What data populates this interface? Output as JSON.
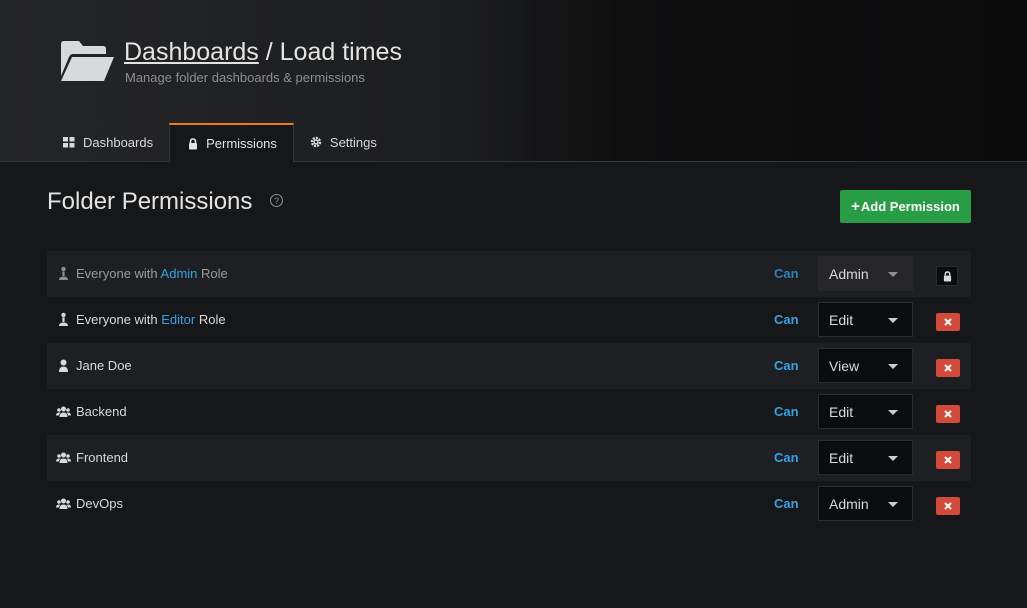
{
  "header": {
    "breadcrumb": "Dashboards",
    "separator": " / ",
    "title": "Load times",
    "subtitle": "Manage folder dashboards & permissions"
  },
  "tabs": [
    {
      "label": "Dashboards",
      "icon": "th-large-icon",
      "active": false
    },
    {
      "label": "Permissions",
      "icon": "lock-icon",
      "active": true
    },
    {
      "label": "Settings",
      "icon": "gear-icon",
      "active": false
    }
  ],
  "main": {
    "title": "Folder Permissions",
    "help": "?",
    "add_button": {
      "plus": "+",
      "label": "Add Permission"
    }
  },
  "permissions": [
    {
      "prefix": "Everyone with ",
      "role": "Admin",
      "suffix": " Role",
      "icon": "user-role-icon",
      "can": "Can",
      "level": "Admin",
      "locked": true
    },
    {
      "prefix": "Everyone with ",
      "role": "Editor",
      "suffix": " Role",
      "icon": "user-role-icon",
      "can": "Can",
      "level": "Edit",
      "locked": false
    },
    {
      "name": "Jane Doe",
      "icon": "user-icon",
      "can": "Can",
      "level": "View",
      "locked": false
    },
    {
      "name": "Backend",
      "icon": "users-icon",
      "can": "Can",
      "level": "Edit",
      "locked": false
    },
    {
      "name": "Frontend",
      "icon": "users-icon",
      "can": "Can",
      "level": "Edit",
      "locked": false
    },
    {
      "name": "DevOps",
      "icon": "users-icon",
      "can": "Can",
      "level": "Admin",
      "locked": false
    }
  ],
  "colors": {
    "accent_blue": "#33a2e5",
    "active_tab": "#eb7b18",
    "add_green": "#299c46",
    "remove_red": "#d44a3a"
  }
}
